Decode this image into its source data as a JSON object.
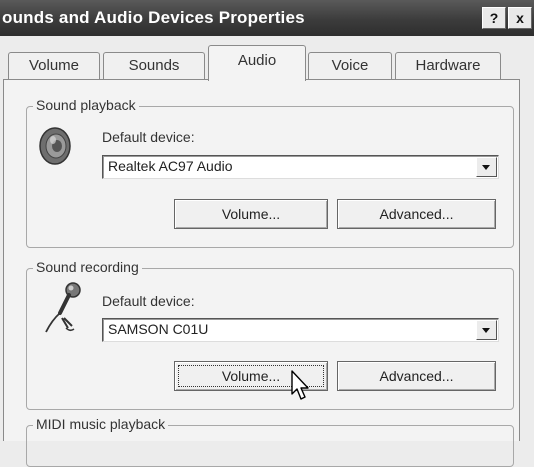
{
  "window": {
    "title": "ounds and Audio Devices Properties",
    "help_label": "?",
    "close_label": "x"
  },
  "tabs": [
    {
      "label": "Volume"
    },
    {
      "label": "Sounds"
    },
    {
      "label": "Audio"
    },
    {
      "label": "Voice"
    },
    {
      "label": "Hardware"
    }
  ],
  "playback": {
    "group_label": "Sound playback",
    "device_label": "Default device:",
    "device_value": "Realtek AC97 Audio",
    "volume_label": "Volume...",
    "advanced_label": "Advanced..."
  },
  "recording": {
    "group_label": "Sound recording",
    "device_label": "Default device:",
    "device_value": "SAMSON C01U",
    "volume_label": "Volume...",
    "advanced_label": "Advanced..."
  },
  "midi": {
    "group_label": "MIDI music playback"
  }
}
